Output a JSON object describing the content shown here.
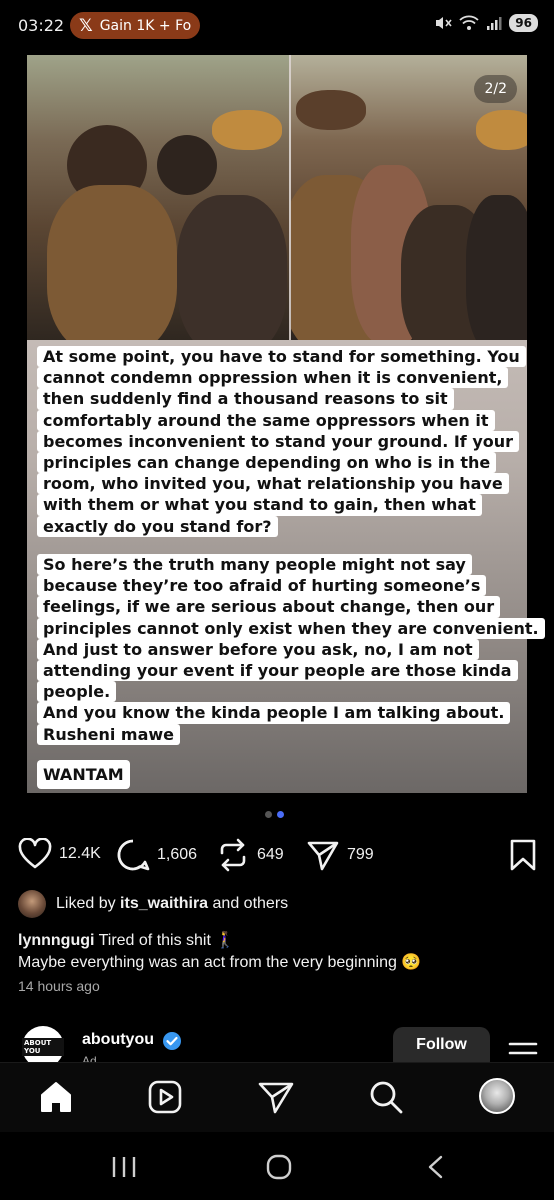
{
  "status_bar": {
    "time": "03:22",
    "notification": {
      "icon": "x-logo-icon",
      "text": "Gain 1K + Fo"
    },
    "battery": "96"
  },
  "post": {
    "page_indicator": "2/2",
    "paragraph1": [
      "At some point, you have to stand for something. You",
      "cannot condemn oppression when it is convenient,",
      "then suddenly find a thousand reasons to sit",
      "comfortably around the same oppressors when it",
      "becomes inconvenient to stand your ground. If your",
      "principles can change depending on who is in the",
      "room, who invited you, what relationship you have",
      "with them or what you stand to gain, then what",
      "exactly do you stand for?"
    ],
    "paragraph2": [
      "So here’s the truth many people might not say",
      "because they’re too afraid of hurting someone’s",
      "feelings, if we are serious about change, then our",
      "principles cannot only exist when they are convenient.",
      "And just to answer before you ask, no, I am not",
      "attending your event if your people are those kinda",
      "people.",
      "And you know the kinda people I am talking about.",
      "Rusheni mawe"
    ],
    "tag": "WANTAM"
  },
  "actions": {
    "likes": "12.4K",
    "comments": "1,606",
    "reposts": "649",
    "shares": "799"
  },
  "liked_by": {
    "prefix": "Liked by",
    "user": "its_waithira",
    "suffix": "and others"
  },
  "caption": {
    "username": "lynnngugi",
    "line1": "Tired of this shit 🚶‍♀️",
    "line2": "Maybe everything was an act from the very beginning 🥺"
  },
  "timestamp": "14 hours ago",
  "next_post": {
    "avatar_text": "ABOUT YOU",
    "username": "aboutyou",
    "subtitle": "Ad",
    "follow_label": "Follow"
  },
  "colors": {
    "accent_blue": "#4a6cf7",
    "verified_blue": "#3897f0",
    "notif_pill": "#8a3a18"
  }
}
